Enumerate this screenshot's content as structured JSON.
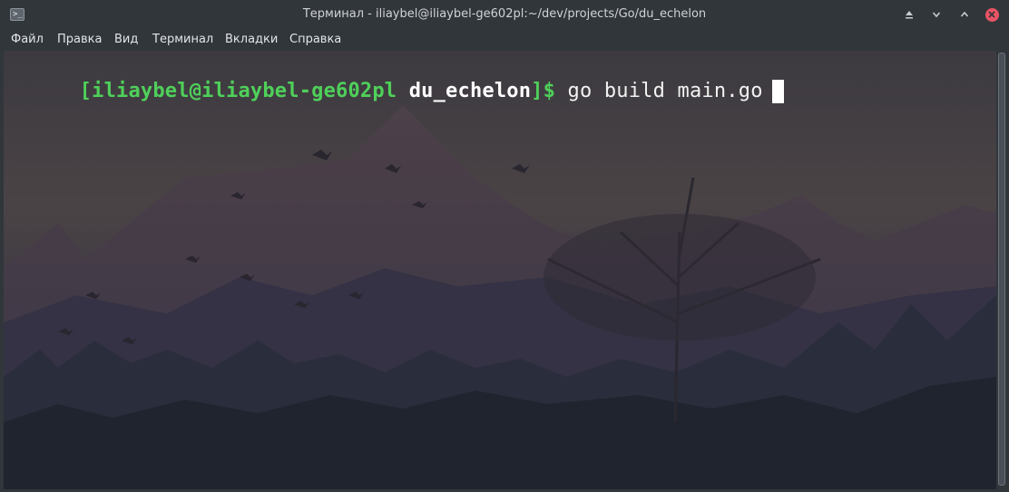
{
  "window": {
    "title": "Терминал - iliaybel@iliaybel-ge602pl:~/dev/projects/Go/du_echelon",
    "app_icon_text": ">_",
    "buttons": [
      "keep-above-icon",
      "minimize-icon",
      "maximize-icon",
      "close-icon"
    ]
  },
  "menu": {
    "items": [
      {
        "label": "Файл"
      },
      {
        "label": "Правка"
      },
      {
        "label": "Вид"
      },
      {
        "label": "Терминал"
      },
      {
        "label": "Вкладки"
      },
      {
        "label": "Справка"
      }
    ]
  },
  "terminal": {
    "prompt_open": "[",
    "user_host": "iliaybel@iliaybel-ge602pl",
    "cwd": "du_echelon",
    "prompt_close": "]$",
    "command": "go build main.go",
    "colors": {
      "prompt": "#4fd05a",
      "cwd": "#ffffff",
      "text": "#f2f2f2",
      "close_button": "#e95364"
    }
  }
}
